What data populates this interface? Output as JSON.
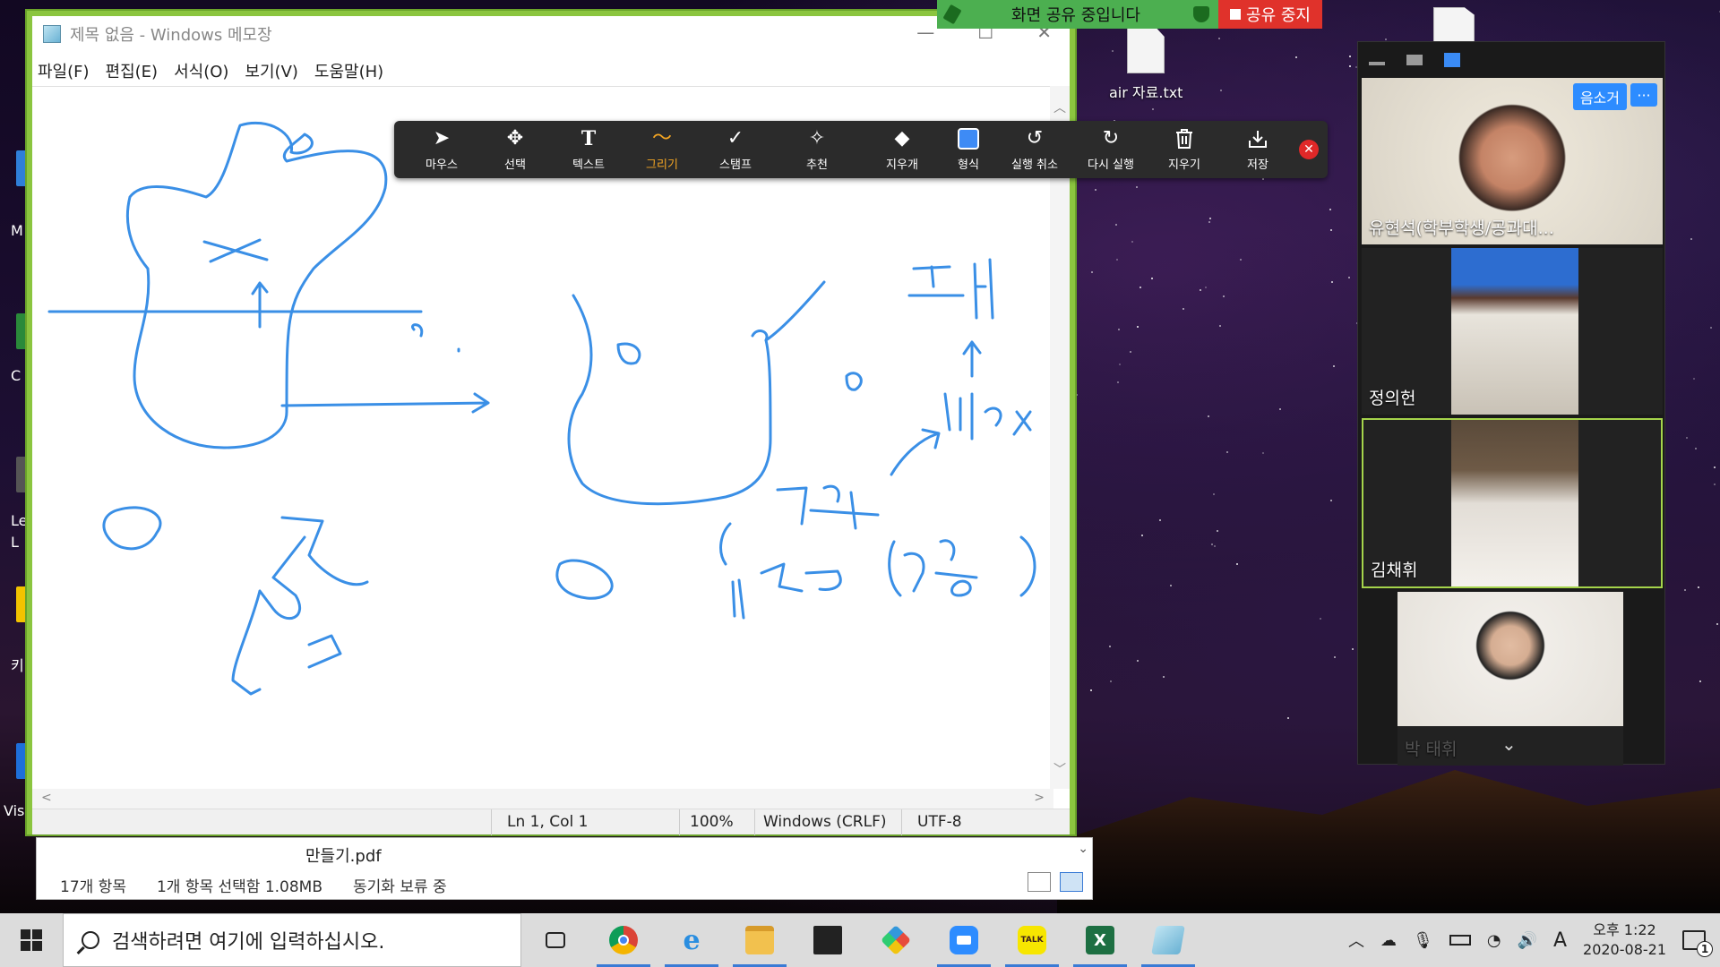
{
  "notepad": {
    "title": "제목 없음 - Windows 메모장",
    "window_controls": [
      "—",
      "☐",
      "✕"
    ],
    "menu": [
      "파일(F)",
      "편집(E)",
      "서식(O)",
      "보기(V)",
      "도움말(H)"
    ],
    "status": {
      "position": "Ln 1, Col 1",
      "zoom": "100%",
      "line_ending": "Windows (CRLF)",
      "encoding": "UTF-8"
    }
  },
  "annotation_toolbar": {
    "tools": [
      {
        "label": "마우스",
        "icon": "arrow-cursor-icon",
        "glyph": "➤"
      },
      {
        "label": "선택",
        "icon": "move-icon",
        "glyph": "✥"
      },
      {
        "label": "텍스트",
        "icon": "text-icon",
        "glyph": "T"
      },
      {
        "label": "그리기",
        "icon": "draw-wave-icon",
        "glyph": "〜",
        "active": true
      },
      {
        "label": "스탬프",
        "icon": "checkmark-icon",
        "glyph": "✓"
      },
      {
        "label": "추천",
        "icon": "magic-wand-icon",
        "glyph": "✧"
      },
      {
        "label": "지우개",
        "icon": "eraser-icon",
        "glyph": "◆"
      },
      {
        "label": "형식",
        "icon": "format-square-icon",
        "glyph": ""
      },
      {
        "label": "실행 취소",
        "icon": "undo-icon",
        "glyph": "↺"
      },
      {
        "label": "다시 실행",
        "icon": "redo-icon",
        "glyph": "↻"
      },
      {
        "label": "지우기",
        "icon": "trash-icon",
        "glyph": "🗑"
      },
      {
        "label": "저장",
        "icon": "save-download-icon",
        "glyph": "⤓"
      }
    ],
    "close_glyph": "✕",
    "ink_color": "#3a8fe6"
  },
  "share_banner": {
    "status_text": "화면 공유 중입니다",
    "stop_text": "공유 중지",
    "status_color": "#4caf50",
    "stop_color": "#e0322b"
  },
  "desktop": {
    "file_icon_label": "air 자료.txt",
    "left_labels": [
      "M",
      "C",
      "Le",
      "L",
      "키",
      "Vis"
    ]
  },
  "explorer": {
    "file_name": "만들기.pdf",
    "item_count": "17개 항목",
    "selected": "1개 항목 선택함 1.08MB",
    "sync_status": "동기화 보류 중"
  },
  "gallery": {
    "participants": [
      {
        "name": "유현석(학부학생/공과대...",
        "mute_label": "음소거",
        "more_label": "···"
      },
      {
        "name": "정의헌"
      },
      {
        "name": "김채휘",
        "active": true
      },
      {
        "name": "박 태휘"
      }
    ]
  },
  "taskbar": {
    "search_placeholder": "검색하려면 여기에 입력하십시오.",
    "apps": [
      {
        "name": "task-view-icon",
        "label": ""
      },
      {
        "name": "chrome-icon",
        "label": ""
      },
      {
        "name": "internet-explorer-icon",
        "label": "e"
      },
      {
        "name": "file-explorer-icon",
        "label": ""
      },
      {
        "name": "store-icon",
        "label": ""
      },
      {
        "name": "paint-icon",
        "label": ""
      },
      {
        "name": "zoom-icon",
        "label": ""
      },
      {
        "name": "kakaotalk-icon",
        "label": "TALK"
      },
      {
        "name": "excel-icon",
        "label": "X"
      },
      {
        "name": "notepad-icon",
        "label": ""
      }
    ],
    "ime": "A",
    "time": "오후 1:22",
    "date": "2020-08-21",
    "notification_count": "1"
  }
}
